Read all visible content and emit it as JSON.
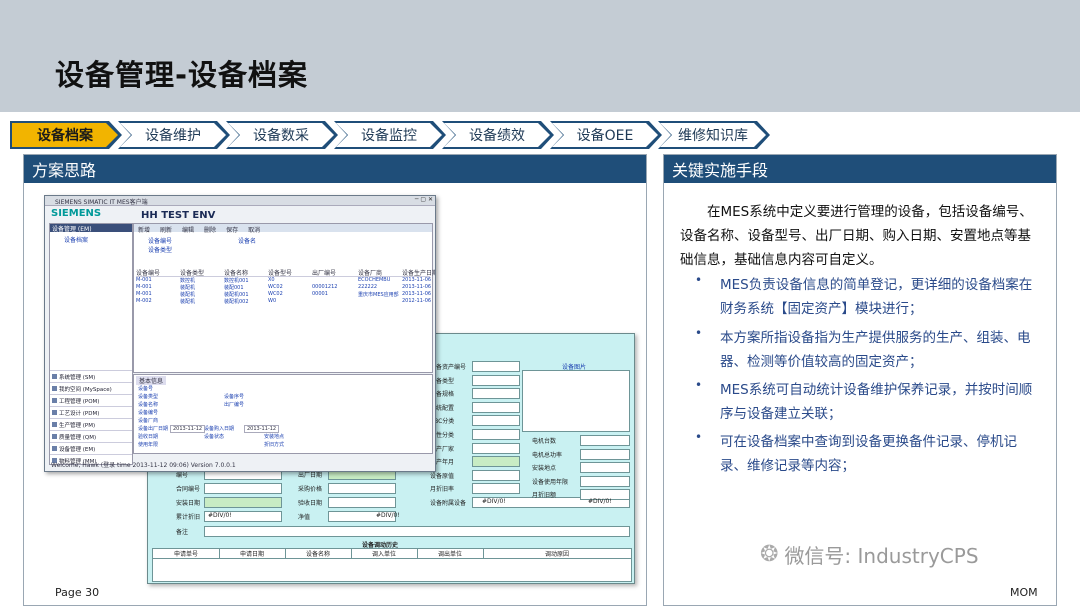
{
  "slide": {
    "title": "设备管理-设备档案",
    "page_number": "Page 30",
    "footer_tag": "MOM",
    "watermark": "微信号: IndustryCPS"
  },
  "nav": {
    "steps": [
      "设备档案",
      "设备维护",
      "设备数采",
      "设备监控",
      "设备绩效",
      "设备OEE",
      "维修知识库"
    ],
    "active_index": 0,
    "colors": {
      "active": "#f2b400",
      "outline": "#1f4e79"
    }
  },
  "left_panel": {
    "title": "方案思路"
  },
  "right_panel": {
    "title": "关键实施手段",
    "intro": "在MES系统中定义要进行管理的设备，包括设备编号、设备名称、设备型号、出厂日期、购入日期、安置地点等基础信息，基础信息内容可自定义。",
    "bullets": [
      "MES负责设备信息的简单登记，更详细的设备档案在财务系统【固定资产】模块进行；",
      "本方案所指设备指为生产提供服务的生产、组装、电器、检测等价值较高的固定资产；",
      "MES系统可自动统计设备维护保养记录，并按时间顺序与设备建立关联；",
      "可在设备档案中查询到设备更换备件记录、停机记录、维修记录等内容；"
    ]
  },
  "app_window": {
    "titlebar": "SIEMENS SIMATIC IT MES客户端",
    "brand": "SIEMENS",
    "env": "HH TEST ENV",
    "tree_header": "设备管理 (EM)",
    "tree_items": [
      "设备档案"
    ],
    "side_menu": [
      "系统管理 (SM)",
      "我的空间 (MySpace)",
      "工程管理 (POM)",
      "工艺设计 (PDM)",
      "生产管理 (PM)",
      "质量管理 (QM)",
      "设备管理 (EM)",
      "物料管理 (MM)"
    ],
    "toolbar": [
      "新增",
      "刷新",
      "编辑",
      "删除",
      "保存",
      "取消"
    ],
    "filter_labels": [
      "设备编号",
      "设备类型",
      "设备名"
    ],
    "table_headers": [
      "设备编号",
      "设备类型",
      "设备名称",
      "设备型号",
      "出厂编号",
      "设备厂商",
      "设备生产日期"
    ],
    "table_rows": [
      [
        "M-001",
        "数控机",
        "数控机001",
        "X0",
        "",
        "ECOCHEMBU",
        "2013-11-06"
      ],
      [
        "M-001",
        "装配机",
        "装配001",
        "WC02",
        "00001212",
        "222222",
        "2013-11-06"
      ],
      [
        "M-001",
        "装配机",
        "装配机001",
        "WC02",
        "00001",
        "重庆市MES应用部",
        "2013-11-06"
      ],
      [
        "M-002",
        "装配机",
        "装配机002",
        "W0",
        "",
        "",
        "2012-11-06"
      ]
    ],
    "detail_tab": "基本信息",
    "detail_labels": [
      "设备号",
      "设备类型",
      "设备名称",
      "设备序号",
      "设备编号",
      "出厂编号",
      "设备厂商",
      "设备出厂日期",
      "设备购入日期",
      "验收日期",
      "设备状态",
      "安装地点",
      "使用年限",
      "折旧方式"
    ],
    "detail_dates": [
      "2013-11-12",
      "2013-11-12"
    ],
    "status_bar": "Welcome, Hawk (登录 time 2013-11-12 09:06) Version 7.0.0.1"
  },
  "form_window": {
    "right_labels": [
      "设备资产编号",
      "设备类型",
      "设备规格",
      "系统配置",
      "ABC分类",
      "属性分类",
      "生产厂家",
      "生产年月",
      "设备原值",
      "月折旧率",
      "设备附属设备"
    ],
    "photo_label": "设备图片",
    "motor_labels": [
      "电机台数",
      "电机总功率",
      "安装地点",
      "设备使用年限",
      "月折旧额"
    ],
    "left_labels": [
      "编号",
      "合同编号",
      "安装日期",
      "累计折旧",
      "备注"
    ],
    "mid_labels": [
      "出厂日期",
      "采购价格",
      "验收日期",
      "净值"
    ],
    "div_values": [
      "#DIV/0!",
      "#DIV/0!",
      "#DIV/0!",
      "#DIV/0!"
    ],
    "history_title": "设备调动历史",
    "history_headers": [
      "申请单号",
      "申请日期",
      "设备名称",
      "调入单位",
      "调出单位",
      "调动原因"
    ]
  }
}
